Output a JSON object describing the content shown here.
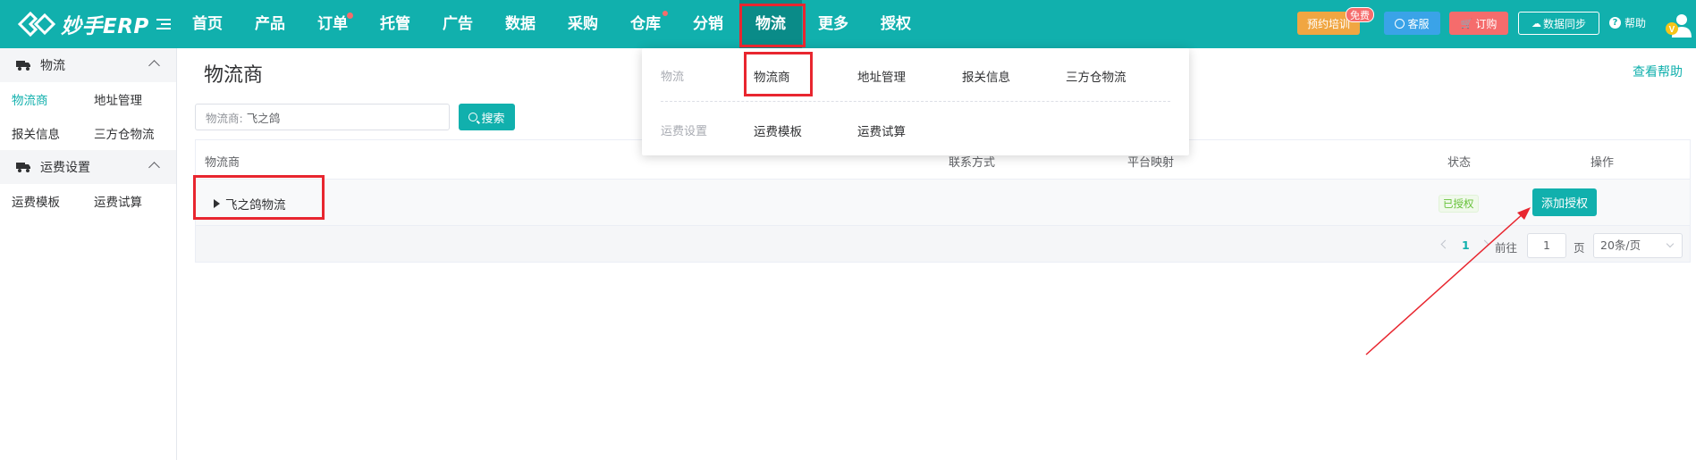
{
  "app": {
    "logo_text": "妙手ERP"
  },
  "nav": {
    "items": [
      {
        "label": "首页"
      },
      {
        "label": "产品"
      },
      {
        "label": "订单"
      },
      {
        "label": "托管"
      },
      {
        "label": "广告"
      },
      {
        "label": "数据"
      },
      {
        "label": "采购"
      },
      {
        "label": "仓库"
      },
      {
        "label": "分销"
      },
      {
        "label": "物流"
      },
      {
        "label": "更多"
      },
      {
        "label": "授权"
      }
    ],
    "active": "物流"
  },
  "top_right": {
    "training": "预约培训",
    "free_badge": "免费",
    "service": "客服",
    "order": "订购",
    "sync": "数据同步",
    "help": "帮助",
    "avatar_badge": "V"
  },
  "sidebar": {
    "groups": [
      {
        "title": "物流",
        "links": [
          [
            "物流商",
            "地址管理"
          ],
          [
            "报关信息",
            "三方仓物流"
          ]
        ]
      },
      {
        "title": "运费设置",
        "links": [
          [
            "运费模板",
            "运费试算"
          ]
        ]
      }
    ],
    "active_link": "物流商"
  },
  "main": {
    "title": "物流商",
    "view_help": "查看帮助",
    "search": {
      "label": "物流商:",
      "value": "飞之鸽",
      "button": "搜索"
    },
    "table": {
      "columns": [
        "物流商",
        "联系方式",
        "平台映射",
        "状态",
        "操作"
      ],
      "rows": [
        {
          "name": "飞之鸽物流",
          "status": "已授权",
          "action": "添加授权"
        }
      ]
    },
    "pagination": {
      "current": "1",
      "goto_label": "前往",
      "goto_value": "1",
      "page_suffix": "页",
      "page_size": "20条/页"
    }
  },
  "dropdown": {
    "sections": [
      {
        "label": "物流",
        "items": [
          "物流商",
          "地址管理",
          "报关信息",
          "三方仓物流"
        ]
      },
      {
        "label": "运费设置",
        "items": [
          "运费模板",
          "运费试算"
        ]
      }
    ]
  },
  "colors": {
    "brand": "#11b0ad",
    "highlight": "#e8262f",
    "success": "#67c23a"
  }
}
